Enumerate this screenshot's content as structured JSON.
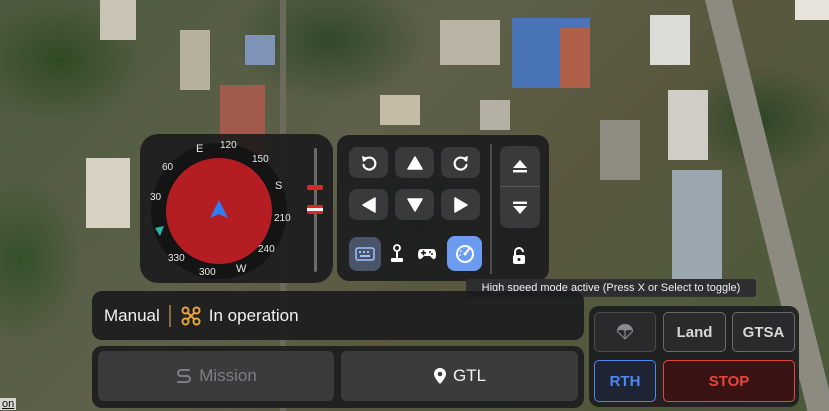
{
  "map": {
    "attribution": "on"
  },
  "compass": {
    "cardinals": {
      "east": "E",
      "south": "S",
      "west": "W"
    },
    "ticks": [
      "30",
      "60",
      "120",
      "150",
      "210",
      "240",
      "300",
      "330"
    ],
    "heading_deg": 0,
    "disk_color": "#b41e23",
    "arrow_color": "#2f7df6",
    "marker_color": "#2ab3a8"
  },
  "controls": {
    "rotate_left_icon": "rotate-ccw-icon",
    "forward_icon": "arrow-up-icon",
    "rotate_right_icon": "rotate-cw-icon",
    "left_icon": "arrow-left-icon",
    "backward_icon": "arrow-down-icon",
    "right_icon": "arrow-right-icon",
    "ascend_icon": "eject-up-icon",
    "descend_icon": "eject-down-icon",
    "input_modes": [
      "keyboard-icon",
      "joystick-icon",
      "gamepad-icon",
      "speedometer-icon"
    ],
    "active_mode": "speedometer-icon",
    "active_color": "#6b9cf0",
    "lock_icon": "unlock-icon"
  },
  "tooltip": {
    "text": "High speed mode active (Press X or Select to toggle)"
  },
  "status": {
    "mode": "Manual",
    "state": "In operation",
    "state_icon": "drone-icon",
    "state_color": "#e8a33a"
  },
  "navigation": {
    "mission_label": "Mission",
    "gtl_label": "GTL"
  },
  "actions": {
    "parachute_icon": "parachute-icon",
    "land_label": "Land",
    "gtsa_label": "GTSA",
    "rth_label": "RTH",
    "stop_label": "STOP",
    "rth_color": "#4e88f0",
    "stop_color": "#e4463f"
  }
}
